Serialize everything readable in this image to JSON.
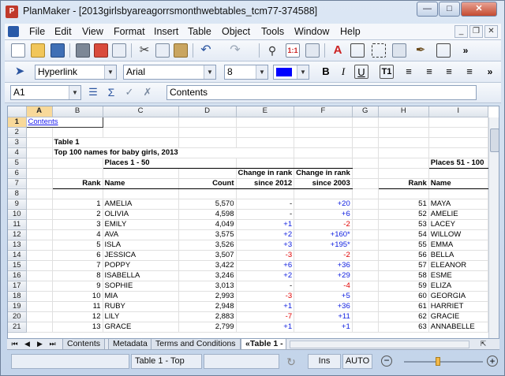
{
  "window": {
    "title": "PlanMaker - [2013girlsbyareagorrsmonthwebtables_tcm77-374588]"
  },
  "menu": [
    "File",
    "Edit",
    "View",
    "Format",
    "Insert",
    "Table",
    "Object",
    "Tools",
    "Window",
    "Help"
  ],
  "format_bar": {
    "style": "Hyperlink",
    "font": "Arial",
    "size": "8",
    "color": "#0000ff"
  },
  "formula_bar": {
    "cell_ref": "A1",
    "content": "Contents"
  },
  "columns": [
    "A",
    "B",
    "C",
    "D",
    "E",
    "F",
    "G",
    "H",
    "I"
  ],
  "row_numbers": [
    "1",
    "2",
    "3",
    "4",
    "5",
    "6",
    "7",
    "8",
    "9",
    "10",
    "11",
    "12",
    "13",
    "14",
    "15",
    "16",
    "17",
    "18",
    "19",
    "20",
    "21"
  ],
  "cells": {
    "a1": "Contents",
    "table_label": "Table 1",
    "table_title": "Top 100 names for baby girls, 2013",
    "places_1_50": "Places 1 - 50",
    "places_51_100": "Places 51 - 100",
    "change_hdr_1": "Change in rank",
    "change_hdr_2": "Change in rank",
    "hdr_rank": "Rank",
    "hdr_name": "Name",
    "hdr_count": "Count",
    "hdr_since2012": "since 2012",
    "hdr_since2003": "since 2003",
    "hdr_rank_2": "Rank",
    "hdr_name_2": "Name"
  },
  "rows": [
    {
      "rank": "1",
      "name": "AMELIA",
      "count": "5,570",
      "c12": "-",
      "c12c": "n",
      "c03": "+20",
      "c03c": "b",
      "rank2": "51",
      "name2": "MAYA"
    },
    {
      "rank": "2",
      "name": "OLIVIA",
      "count": "4,598",
      "c12": "-",
      "c12c": "n",
      "c03": "+6",
      "c03c": "b",
      "rank2": "52",
      "name2": "AMELIE"
    },
    {
      "rank": "3",
      "name": "EMILY",
      "count": "4,049",
      "c12": "+1",
      "c12c": "b",
      "c03": "-2",
      "c03c": "r",
      "rank2": "53",
      "name2": "LACEY"
    },
    {
      "rank": "4",
      "name": "AVA",
      "count": "3,575",
      "c12": "+2",
      "c12c": "b",
      "c03": "+160*",
      "c03c": "b",
      "rank2": "54",
      "name2": "WILLOW"
    },
    {
      "rank": "5",
      "name": "ISLA",
      "count": "3,526",
      "c12": "+3",
      "c12c": "b",
      "c03": "+195*",
      "c03c": "b",
      "rank2": "55",
      "name2": "EMMA"
    },
    {
      "rank": "6",
      "name": "JESSICA",
      "count": "3,507",
      "c12": "-3",
      "c12c": "r",
      "c03": "-2",
      "c03c": "r",
      "rank2": "56",
      "name2": "BELLA"
    },
    {
      "rank": "7",
      "name": "POPPY",
      "count": "3,422",
      "c12": "+6",
      "c12c": "b",
      "c03": "+36",
      "c03c": "b",
      "rank2": "57",
      "name2": "ELEANOR"
    },
    {
      "rank": "8",
      "name": "ISABELLA",
      "count": "3,246",
      "c12": "+2",
      "c12c": "b",
      "c03": "+29",
      "c03c": "b",
      "rank2": "58",
      "name2": "ESME"
    },
    {
      "rank": "9",
      "name": "SOPHIE",
      "count": "3,013",
      "c12": "-",
      "c12c": "n",
      "c03": "-4",
      "c03c": "r",
      "rank2": "59",
      "name2": "ELIZA"
    },
    {
      "rank": "10",
      "name": "MIA",
      "count": "2,993",
      "c12": "-3",
      "c12c": "r",
      "c03": "+5",
      "c03c": "b",
      "rank2": "60",
      "name2": "GEORGIA"
    },
    {
      "rank": "11",
      "name": "RUBY",
      "count": "2,948",
      "c12": "+1",
      "c12c": "b",
      "c03": "+36",
      "c03c": "b",
      "rank2": "61",
      "name2": "HARRIET"
    },
    {
      "rank": "12",
      "name": "LILY",
      "count": "2,883",
      "c12": "-7",
      "c12c": "r",
      "c03": "+11",
      "c03c": "b",
      "rank2": "62",
      "name2": "GRACIE"
    },
    {
      "rank": "13",
      "name": "GRACE",
      "count": "2,799",
      "c12": "+1",
      "c12c": "b",
      "c03": "+1",
      "c03c": "b",
      "rank2": "63",
      "name2": "ANNABELLE"
    }
  ],
  "sheet_tabs": [
    "Contents",
    "Metadata",
    "Terms and Conditions",
    "«Table 1 - "
  ],
  "status": {
    "sheet": "Table 1 - Top",
    "mode": "Ins",
    "calc": "AUTO"
  }
}
